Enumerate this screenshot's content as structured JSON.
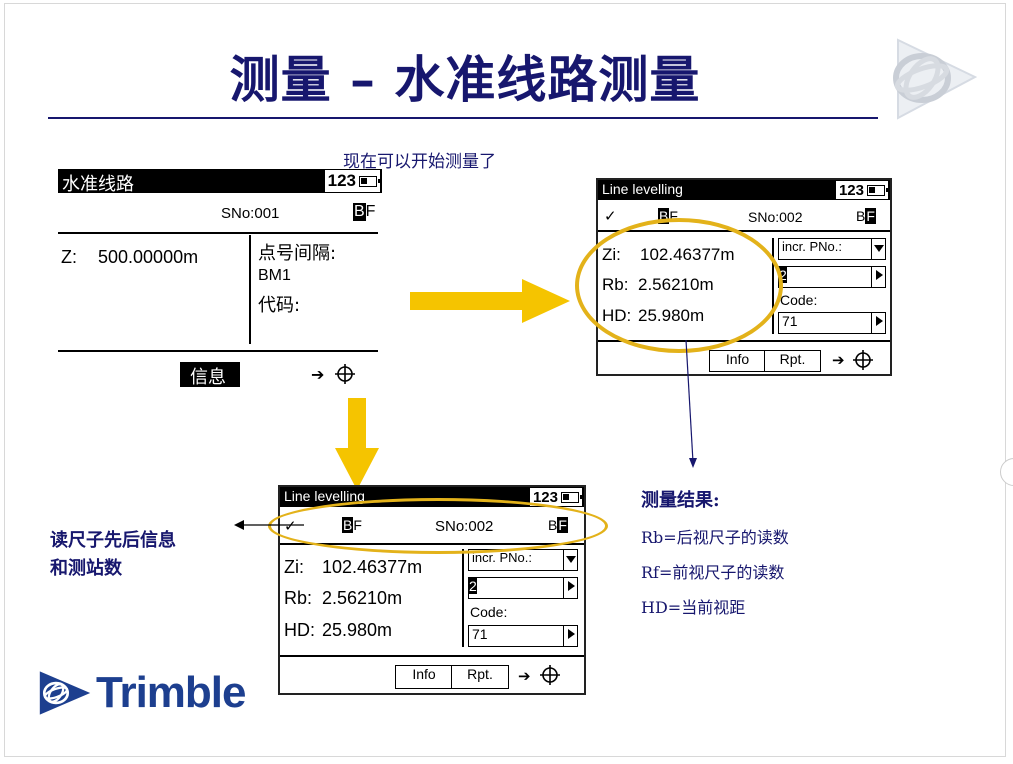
{
  "slide": {
    "title": "测量 – 水准线路测量",
    "subtitle": "现在可以开始测量了",
    "brand": "Trimble"
  },
  "screen_cn": {
    "title": "水准线路",
    "battery_label": "123",
    "sno": "SNo:001",
    "mode_letter": "B",
    "mode_letter2": "F",
    "z_label": "Z:",
    "z_value": "500.00000m",
    "point_interval_label": "点号间隔:",
    "point_value": "BM1",
    "code_label": "代码:",
    "softkey_info": "信息",
    "arrow_label": "➔"
  },
  "screen_en": {
    "title": "Line levelling",
    "battery_label": "123",
    "check": "✓",
    "mode_letter": "B",
    "mode_letter2": "F",
    "sno": "SNo:002",
    "zi_label": "Zi:",
    "zi_value": "102.46377m",
    "rb_label": "Rb:",
    "rb_value": "2.56210m",
    "hd_label": "HD:",
    "hd_value": "25.980m",
    "incr_label": "incr. PNo.:",
    "incr_value": "2",
    "code_label": "Code:",
    "code_value": "71",
    "softkey_info": "Info",
    "softkey_rpt": "Rpt.",
    "arrow_label": "➔"
  },
  "annotations": {
    "left_note_line1": "读尺子先后信息",
    "left_note_line2": "和测站数",
    "result_title": "测量结果:",
    "result_rb": "Rb=后视尺子的读数",
    "result_rf": "Rf=前视尺子的读数",
    "result_hd": "HD=当前视距"
  },
  "colors": {
    "title_blue": "#17176e",
    "arrow_yellow": "#f5c400",
    "ellipse_gold": "#e3b21a",
    "logo_blue": "#1d3f8f"
  },
  "icons": [
    "target-crosshair-icon",
    "battery-icon",
    "right-arrow-icon",
    "dropdown-icon",
    "trimble-globe-icon"
  ]
}
